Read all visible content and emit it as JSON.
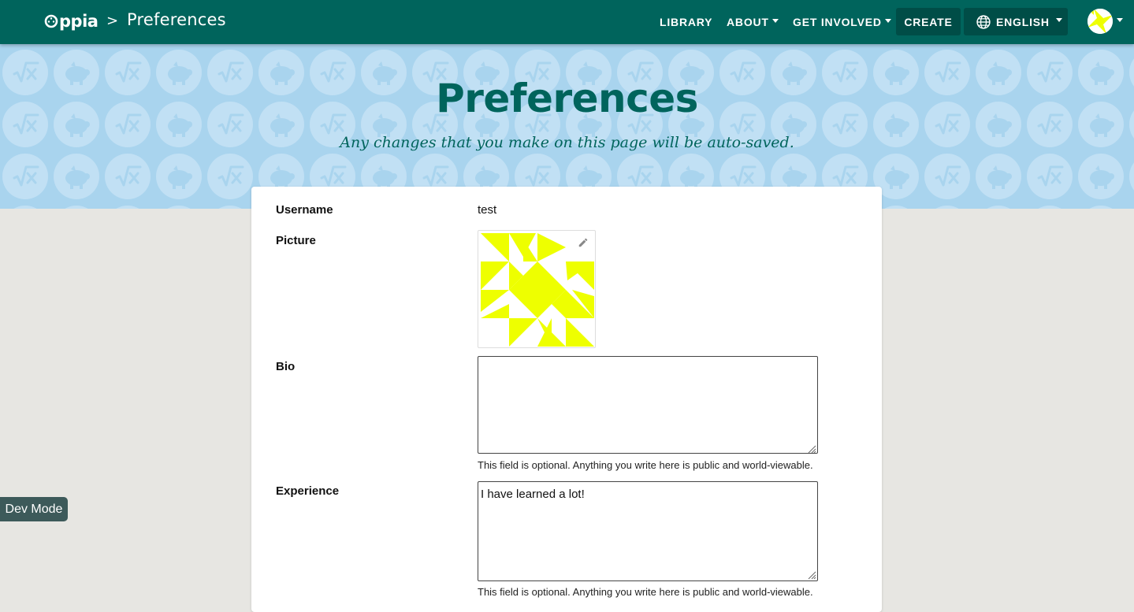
{
  "nav": {
    "logo_text": "ppia",
    "breadcrumb_separator": ">",
    "breadcrumb_title": "Preferences",
    "library_label": "LIBRARY",
    "about_label": "ABOUT",
    "get_involved_label": "GET INVOLVED",
    "create_label": "CREATE",
    "language_label": "ENGLISH",
    "icons": [
      "oppia-logo-icon",
      "chevron-down-icon",
      "globe-icon",
      "avatar"
    ]
  },
  "banner": {
    "title": "Preferences",
    "subtitle": "Any changes that you make on this page will be auto-saved."
  },
  "form": {
    "username_label": "Username",
    "username_value": "test",
    "picture_label": "Picture",
    "bio_label": "Bio",
    "bio_value": "",
    "bio_hint": "This field is optional. Anything you write here is public and world-viewable.",
    "experience_label": "Experience",
    "experience_value": "I have learned a lot!",
    "experience_hint": "This field is optional. Anything you write here is public and world-viewable."
  },
  "dev_mode_label": "Dev Mode",
  "colors": {
    "nav_bg": "#00645c",
    "nav_button_bg": "#004d47",
    "banner_bg": "#a9d4ee",
    "banner_icon": "#c1e0f4",
    "title_color": "#00645c",
    "page_bg": "#e7e6e2",
    "avatar_yellow": "#eeff00",
    "dev_mode_bg": "#3d5a5a"
  }
}
